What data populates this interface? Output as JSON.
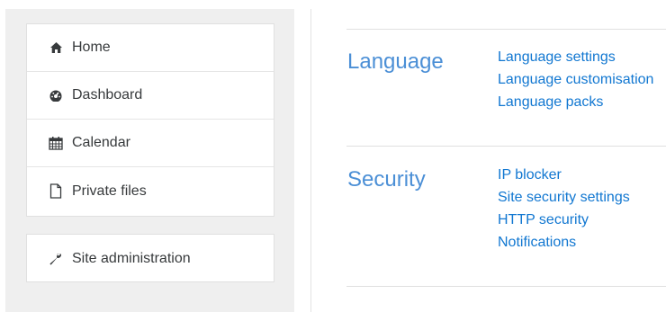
{
  "sidebar": {
    "items": [
      {
        "label": "Home",
        "icon": "home-icon"
      },
      {
        "label": "Dashboard",
        "icon": "dashboard-icon"
      },
      {
        "label": "Calendar",
        "icon": "calendar-icon"
      },
      {
        "label": "Private files",
        "icon": "file-icon"
      }
    ],
    "admin": {
      "label": "Site administration",
      "icon": "wrench-icon"
    }
  },
  "main": {
    "sections": [
      {
        "title": "Language",
        "links": [
          "Language settings",
          "Language customisation",
          "Language packs"
        ]
      },
      {
        "title": "Security",
        "links": [
          "IP blocker",
          "Site security settings",
          "HTTP security",
          "Notifications"
        ]
      }
    ]
  },
  "colors": {
    "section_title": "#4b8fd6",
    "link": "#1177d1",
    "sidebar_bg": "#efefef",
    "text": "#373a3c"
  }
}
